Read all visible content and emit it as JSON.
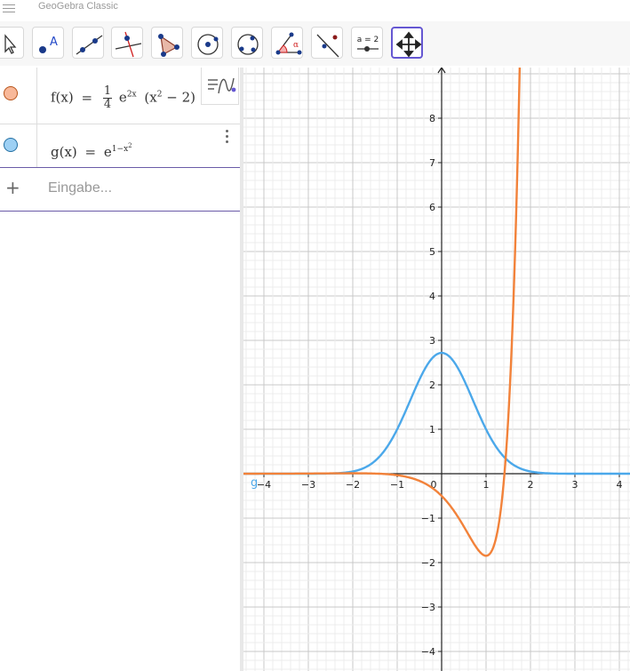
{
  "window": {
    "title": "GeoGebra Classic"
  },
  "toolbar": {
    "tools": [
      {
        "name": "move-tool",
        "label": ""
      },
      {
        "name": "point-tool",
        "label": "A"
      },
      {
        "name": "line-tool",
        "label": ""
      },
      {
        "name": "perpendicular-line-tool",
        "label": ""
      },
      {
        "name": "polygon-tool",
        "label": ""
      },
      {
        "name": "circle-center-point-tool",
        "label": ""
      },
      {
        "name": "circle-three-points-tool",
        "label": ""
      },
      {
        "name": "angle-tool",
        "label": "α"
      },
      {
        "name": "reflect-tool",
        "label": ""
      },
      {
        "name": "slider-tool",
        "label": "a = 2"
      },
      {
        "name": "move-graphics-view-tool",
        "label": ""
      }
    ],
    "selected": "move-graphics-view-tool"
  },
  "algebra": {
    "f": {
      "lhs": "f(x)",
      "eq": "=",
      "num": "1",
      "den": "4",
      "base": "e",
      "exp": "2x",
      "open": "(",
      "var": "x",
      "pow": "2",
      "rest": " − 2",
      "close": ")"
    },
    "g": {
      "lhs": "g(x)",
      "eq": "=",
      "base": "e",
      "exp": "1−x",
      "exp2": "2"
    },
    "input_placeholder": "Eingabe..."
  },
  "graph": {
    "x_ticks": [
      "−4",
      "−3",
      "−2",
      "−1",
      "0",
      "1",
      "2",
      "3",
      "4"
    ],
    "y_ticks": [
      "8",
      "7",
      "6",
      "5",
      "4",
      "3",
      "2",
      "1",
      "−1",
      "−2",
      "−3",
      "−4"
    ],
    "label_g": "g",
    "colors": {
      "f": "#f2823a",
      "g": "#4ba8ea",
      "axis": "#222",
      "grid_major": "#c8c8c8",
      "grid_minor": "#ececec"
    }
  }
}
